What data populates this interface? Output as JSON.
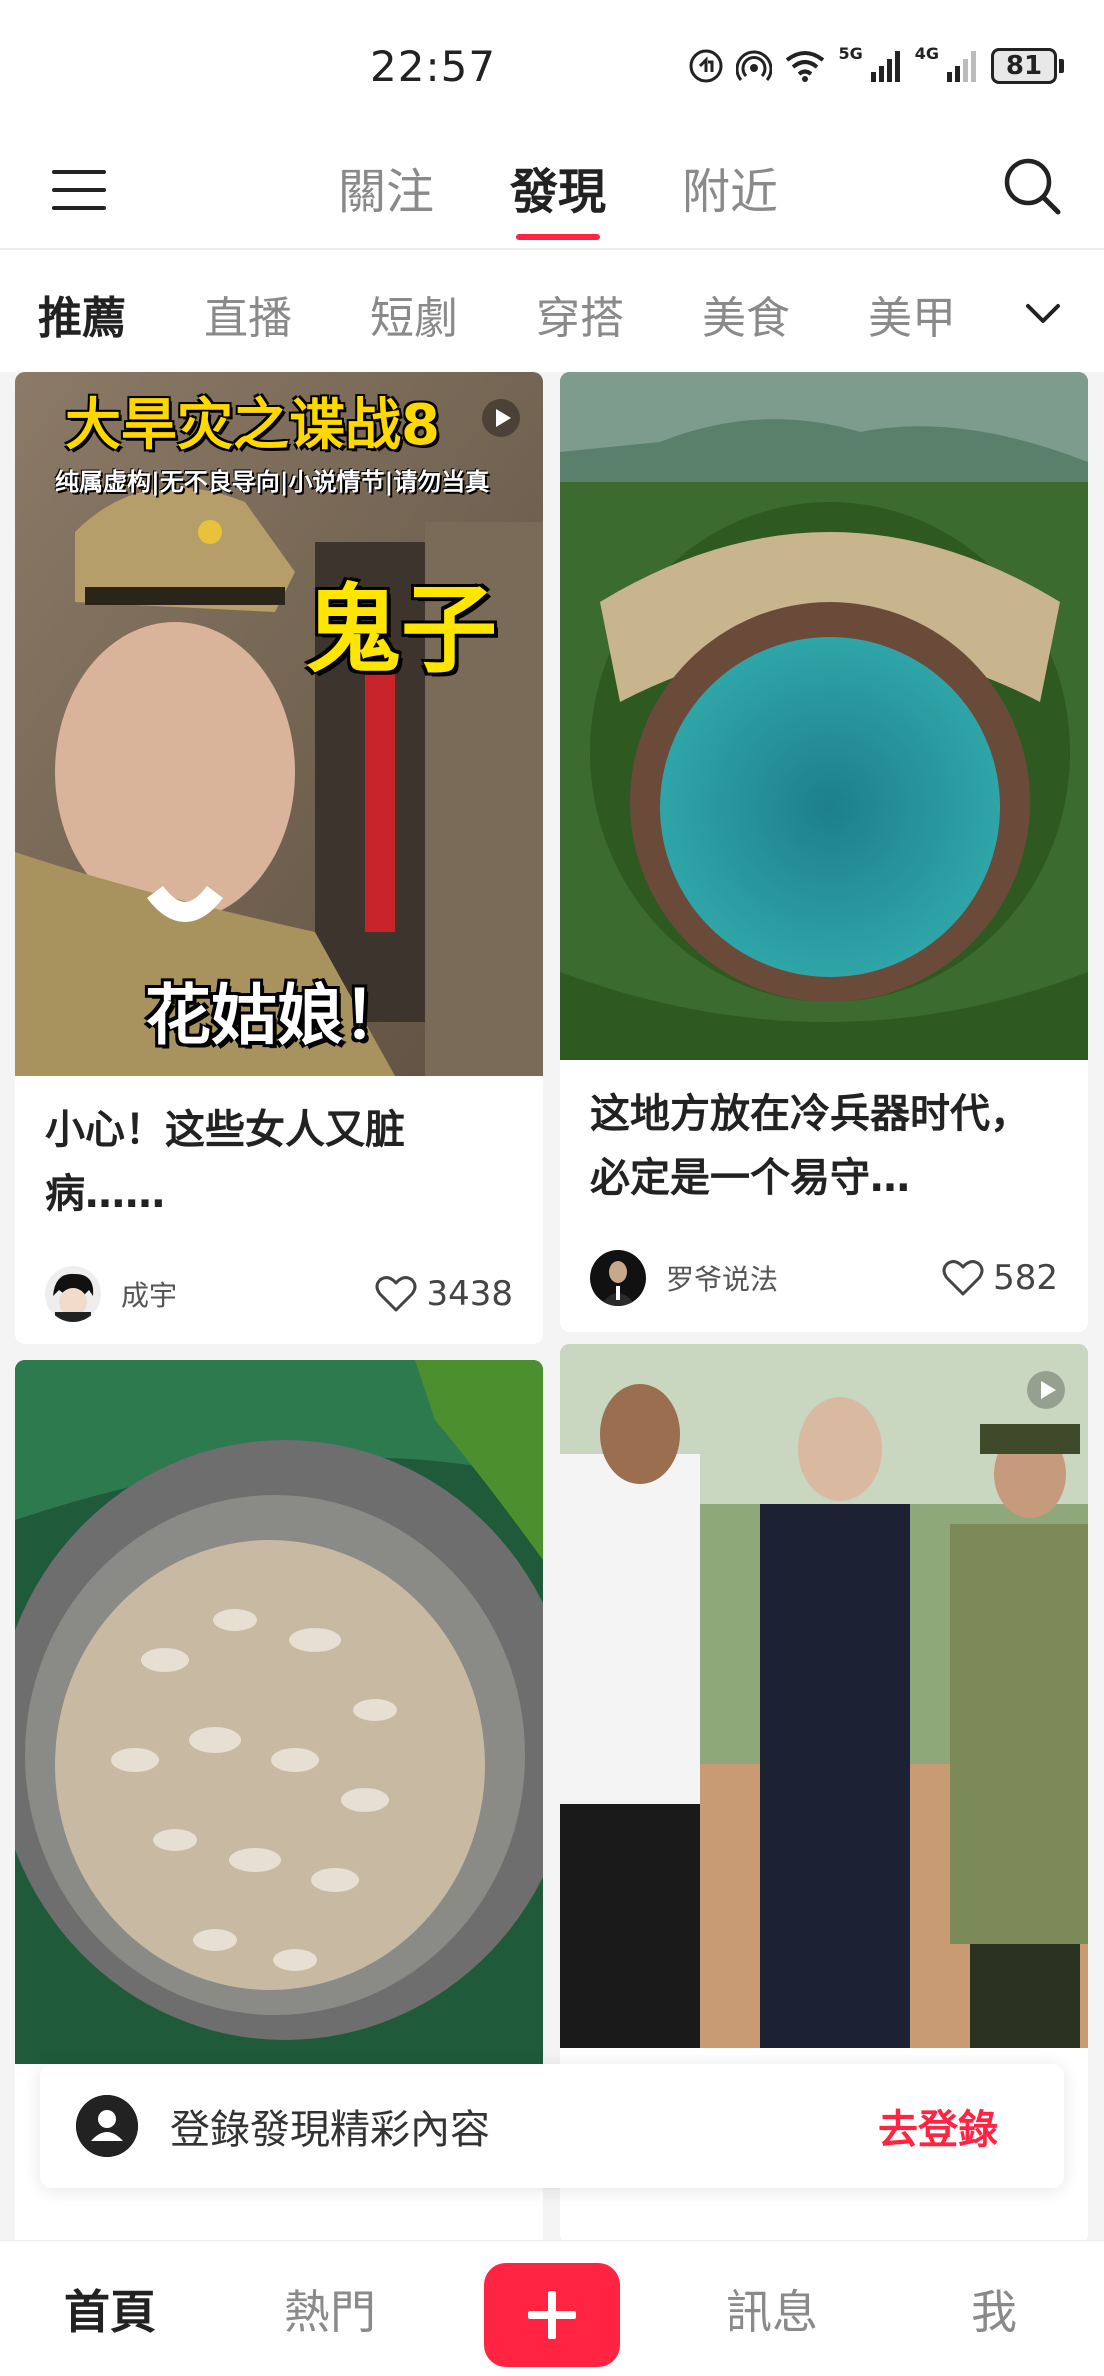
{
  "status_bar": {
    "time": "22:57",
    "network_1": "5G",
    "network_2": "4G",
    "battery": "81"
  },
  "top_nav": {
    "tabs": [
      {
        "label": "關注",
        "active": false
      },
      {
        "label": "發現",
        "active": true
      },
      {
        "label": "附近",
        "active": false
      }
    ]
  },
  "category_bar": {
    "items": [
      {
        "label": "推薦",
        "active": true
      },
      {
        "label": "直播",
        "active": false
      },
      {
        "label": "短劇",
        "active": false
      },
      {
        "label": "穿搭",
        "active": false
      },
      {
        "label": "美食",
        "active": false
      },
      {
        "label": "美甲",
        "active": false
      }
    ]
  },
  "feed": {
    "cards": [
      {
        "title": "小心！这些女人又脏病……",
        "author": "成宇",
        "likes": "3438",
        "is_video": true,
        "overlay": {
          "title": "大旱灾之谍战8",
          "subtitle": "纯属虚构|无不良导向|小说情节|请勿当真",
          "caption_top": "鬼子",
          "caption_bottom": "花姑娘！"
        }
      },
      {
        "title": "这地方放在冷兵器时代，必定是一个易守…",
        "author": "罗爷说法",
        "likes": "582",
        "is_video": false
      },
      {
        "title": "",
        "author": "",
        "likes": "",
        "is_video": false
      },
      {
        "title": "",
        "author": "",
        "likes": "",
        "is_video": true
      }
    ]
  },
  "login_banner": {
    "text": "登錄發現精彩內容",
    "link": "去登錄"
  },
  "bottom_nav": {
    "items": [
      {
        "label": "首頁",
        "active": true
      },
      {
        "label": "熱門",
        "active": false
      },
      {
        "label": "訊息",
        "active": false
      },
      {
        "label": "我",
        "active": false
      }
    ]
  },
  "colors": {
    "accent": "#ff2442",
    "text_primary": "#222222",
    "text_secondary": "#8a8a8a"
  }
}
